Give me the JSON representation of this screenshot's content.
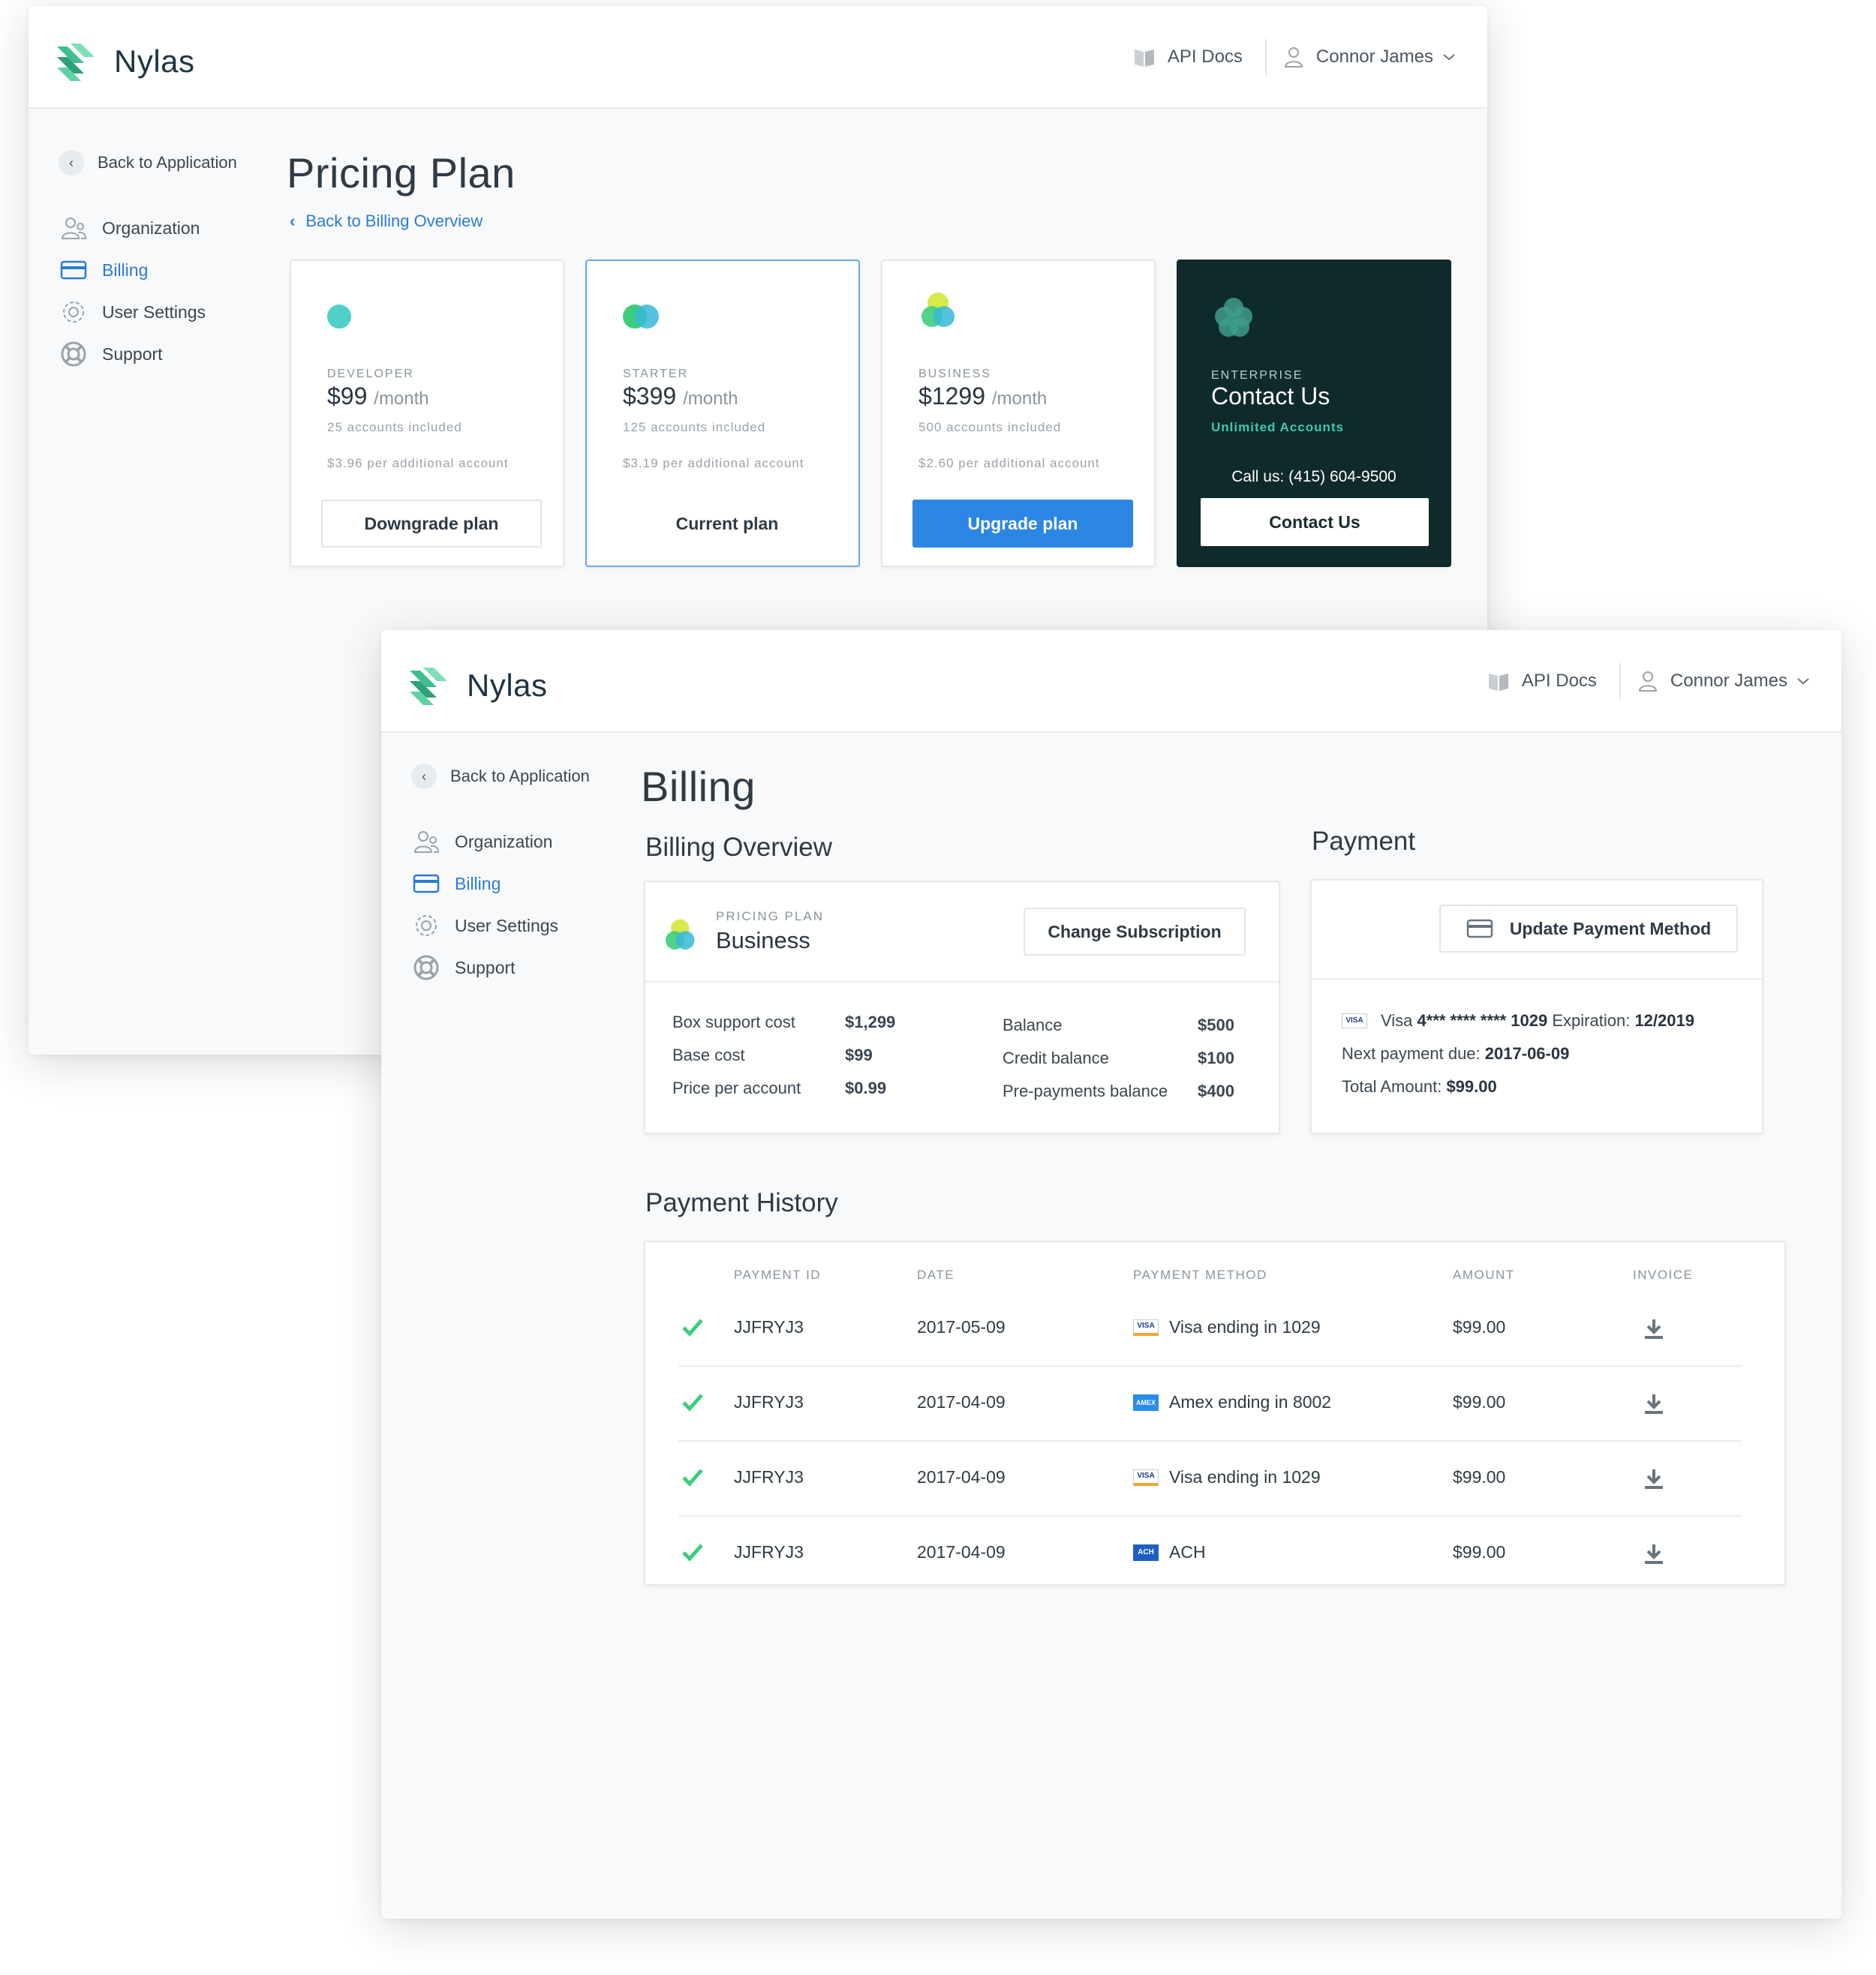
{
  "brand": {
    "name": "Nylas",
    "accent": "#2b7bd6",
    "logo_color": "#3fbf8f"
  },
  "header": {
    "api_docs": "API Docs",
    "user_name": "Connor James"
  },
  "sidebar": {
    "back": "Back to Application",
    "items": [
      {
        "label": "Organization",
        "icon": "organization-icon"
      },
      {
        "label": "Billing",
        "icon": "credit-card-icon",
        "active": true
      },
      {
        "label": "User Settings",
        "icon": "gear-icon"
      },
      {
        "label": "Support",
        "icon": "lifebuoy-icon"
      }
    ]
  },
  "pricing": {
    "title": "Pricing Plan",
    "back_link": "Back to Billing Overview",
    "plans": [
      {
        "name": "DEVELOPER",
        "price": "$99",
        "per": "/month",
        "accounts": "25 accounts included",
        "extra": "$3.96 per additional account",
        "button": "Downgrade plan"
      },
      {
        "name": "STARTER",
        "price": "$399",
        "per": "/month",
        "accounts": "125 accounts included",
        "extra": "$3.19 per additional account",
        "button": "Current plan"
      },
      {
        "name": "BUSINESS",
        "price": "$1299",
        "per": "/month",
        "accounts": "500 accounts included",
        "extra": "$2.60 per additional account",
        "button": "Upgrade plan"
      }
    ],
    "enterprise": {
      "name": "ENTERPRISE",
      "title": "Contact Us",
      "subtitle": "Unlimited Accounts",
      "call": "Call us: (415) 604-9500",
      "button": "Contact Us"
    }
  },
  "billing": {
    "title": "Billing",
    "overview_heading": "Billing Overview",
    "plan_label": "PRICING PLAN",
    "plan_name": "Business",
    "change_button": "Change Subscription",
    "left_rows": [
      {
        "label": "Box support cost",
        "value": "$1,299"
      },
      {
        "label": "Base cost",
        "value": "$99"
      },
      {
        "label": "Price per account",
        "value": "$0.99"
      }
    ],
    "right_rows": [
      {
        "label": "Balance",
        "value": "$500"
      },
      {
        "label": "Credit balance",
        "value": "$100"
      },
      {
        "label": "Pre-payments balance",
        "value": "$400"
      }
    ]
  },
  "payment": {
    "heading": "Payment",
    "update_button": "Update Payment Method",
    "card_brand": "Visa",
    "card_number": "4*** **** **** 1029",
    "expiration_label": "Expiration:",
    "expiration": "12/2019",
    "next_due_label": "Next payment due:",
    "next_due": "2017-06-09",
    "total_label": "Total Amount:",
    "total": "$99.00"
  },
  "history": {
    "heading": "Payment History",
    "columns": [
      "PAYMENT ID",
      "DATE",
      "PAYMENT METHOD",
      "AMOUNT",
      "INVOICE"
    ],
    "rows": [
      {
        "id": "JJFRYJ3",
        "date": "2017-05-09",
        "method": "Visa ending in 1029",
        "method_icon": "VISA",
        "amount": "$99.00"
      },
      {
        "id": "JJFRYJ3",
        "date": "2017-04-09",
        "method": "Amex ending in 8002",
        "method_icon": "AMEX",
        "amount": "$99.00"
      },
      {
        "id": "JJFRYJ3",
        "date": "2017-04-09",
        "method": "Visa ending in 1029",
        "method_icon": "VISA",
        "amount": "$99.00"
      },
      {
        "id": "JJFRYJ3",
        "date": "2017-04-09",
        "method": "ACH",
        "method_icon": "ACH",
        "amount": "$99.00"
      }
    ]
  }
}
